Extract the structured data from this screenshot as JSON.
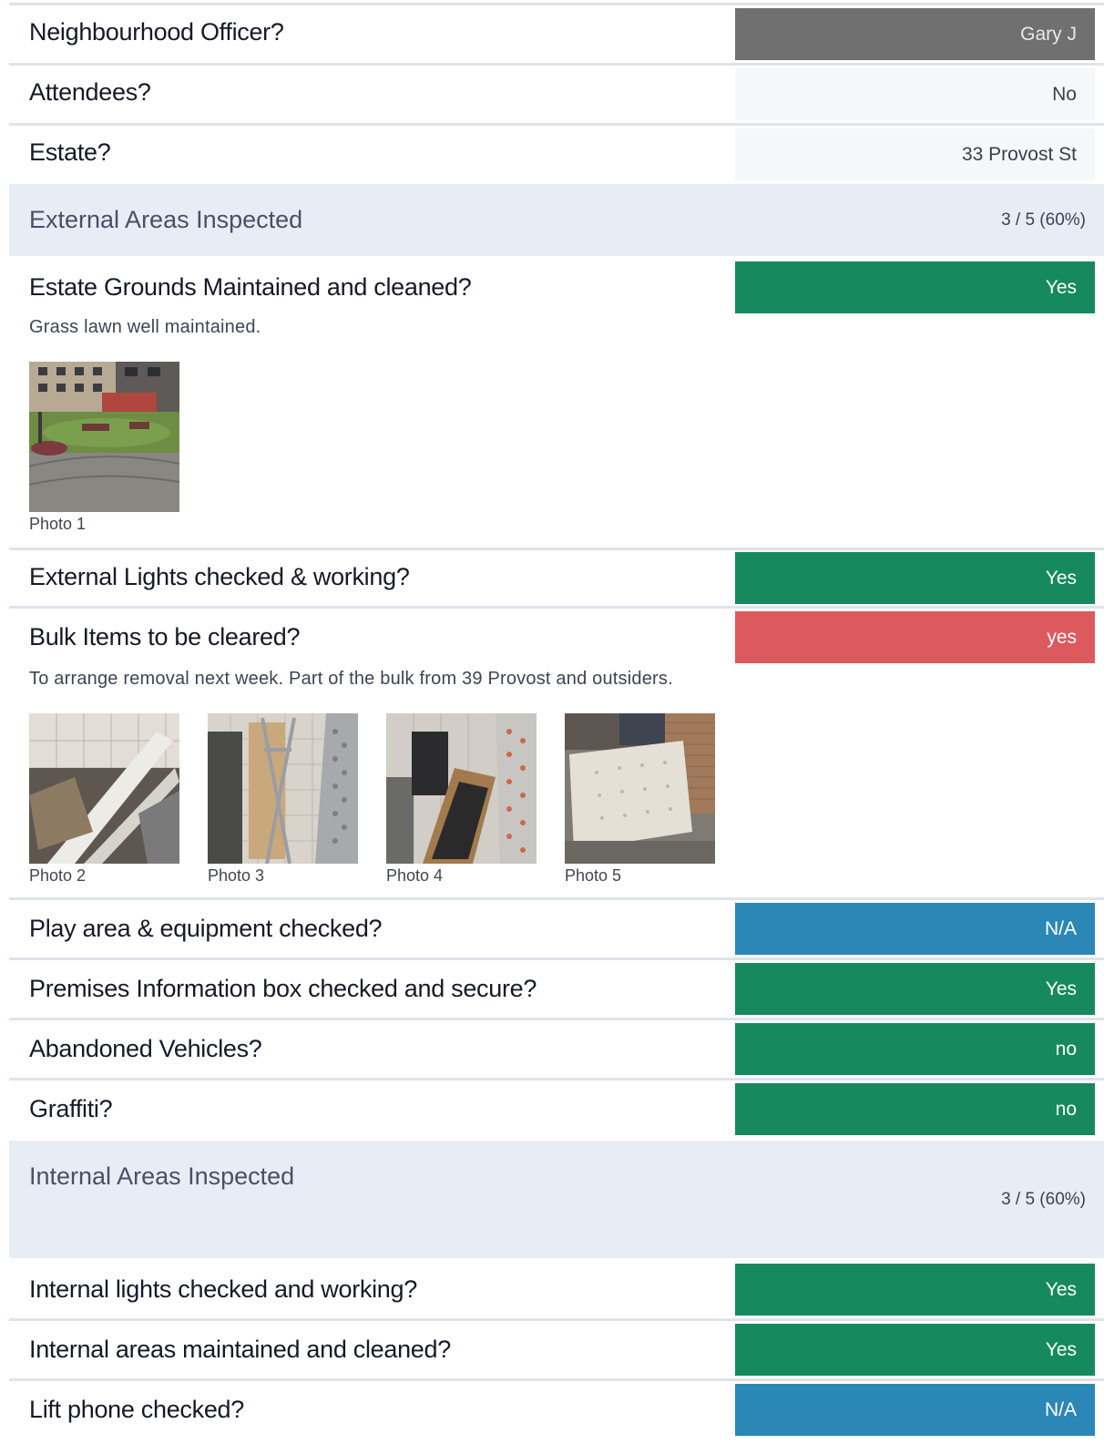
{
  "rows": [
    {
      "question": "Neighbourhood Officer?",
      "answer": "Gary J",
      "style": "grey"
    },
    {
      "question": "Attendees?",
      "answer": "No",
      "style": "plain"
    },
    {
      "question": "Estate?",
      "answer": "33 Provost St",
      "style": "plain"
    }
  ],
  "external": {
    "title": "External Areas Inspected",
    "score": "3 / 5 (60%)",
    "items": [
      {
        "question": "Estate Grounds Maintained and cleaned?",
        "answer": "Yes",
        "style": "green",
        "note": "Grass lawn well maintained.",
        "photos": [
          "Photo 1"
        ]
      },
      {
        "question": "External Lights checked & working?",
        "answer": "Yes",
        "style": "green"
      },
      {
        "question": "Bulk Items to be cleared?",
        "answer": "yes",
        "style": "red",
        "note": "To arrange removal next week.  Part of the bulk from 39 Provost and outsiders.",
        "photos": [
          "Photo 2",
          "Photo 3",
          "Photo 4",
          "Photo 5"
        ]
      },
      {
        "question": "Play area & equipment checked?",
        "answer": "N/A",
        "style": "blue"
      },
      {
        "question": "Premises Information box checked and secure?",
        "answer": "Yes",
        "style": "green"
      },
      {
        "question": "Abandoned Vehicles?",
        "answer": "no",
        "style": "green"
      },
      {
        "question": "Graffiti?",
        "answer": "no",
        "style": "green"
      }
    ]
  },
  "internal": {
    "title": "Internal Areas Inspected",
    "score": "3 / 5 (60%)",
    "items": [
      {
        "question": "Internal lights checked and working?",
        "answer": "Yes",
        "style": "green"
      },
      {
        "question": "Internal areas maintained and cleaned?",
        "answer": "Yes",
        "style": "green"
      },
      {
        "question": "Lift phone checked?",
        "answer": "N/A",
        "style": "blue"
      }
    ]
  }
}
